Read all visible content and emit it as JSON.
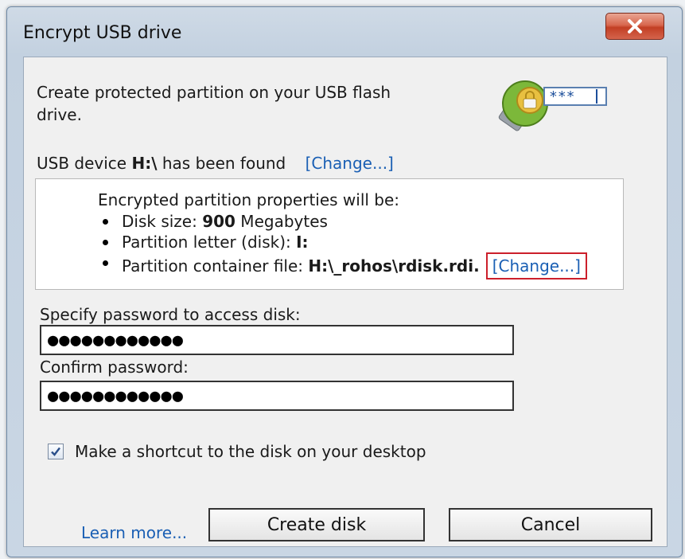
{
  "window": {
    "title": "Encrypt USB drive"
  },
  "intro": {
    "text_line1": "Create protected partition on your USB flash",
    "text_line2": "drive."
  },
  "device": {
    "prefix": "USB device ",
    "drive": "H:\\",
    "suffix": " has been found",
    "change_label": "[Change...]"
  },
  "properties": {
    "heading": "Encrypted partition properties will be:",
    "disk_size_label": "Disk size: ",
    "disk_size_value": "900",
    "disk_size_unit": " Megabytes",
    "partition_letter_label": "Partition letter (disk): ",
    "partition_letter_value": "I:",
    "container_label": "Partition container file: ",
    "container_value": "H:\\_rohos\\rdisk.rdi.",
    "container_change_label": "[Change...]"
  },
  "password": {
    "label": "Specify password to access disk:",
    "value": "●●●●●●●●●●●●",
    "confirm_label": "Confirm password:",
    "confirm_value": "●●●●●●●●●●●●"
  },
  "shortcut": {
    "label": "Make a shortcut to the disk on your desktop",
    "checked": true
  },
  "footer": {
    "learn_more": "Learn more...",
    "create_label": "Create disk",
    "cancel_label": "Cancel"
  },
  "icons": {
    "close": "close-icon",
    "logo": "usb-lock-password-icon",
    "check": "checkmark-icon"
  },
  "colors": {
    "link": "#1a5fb4",
    "highlight_border": "#cc1f2b",
    "close_button": "#c9482e"
  }
}
